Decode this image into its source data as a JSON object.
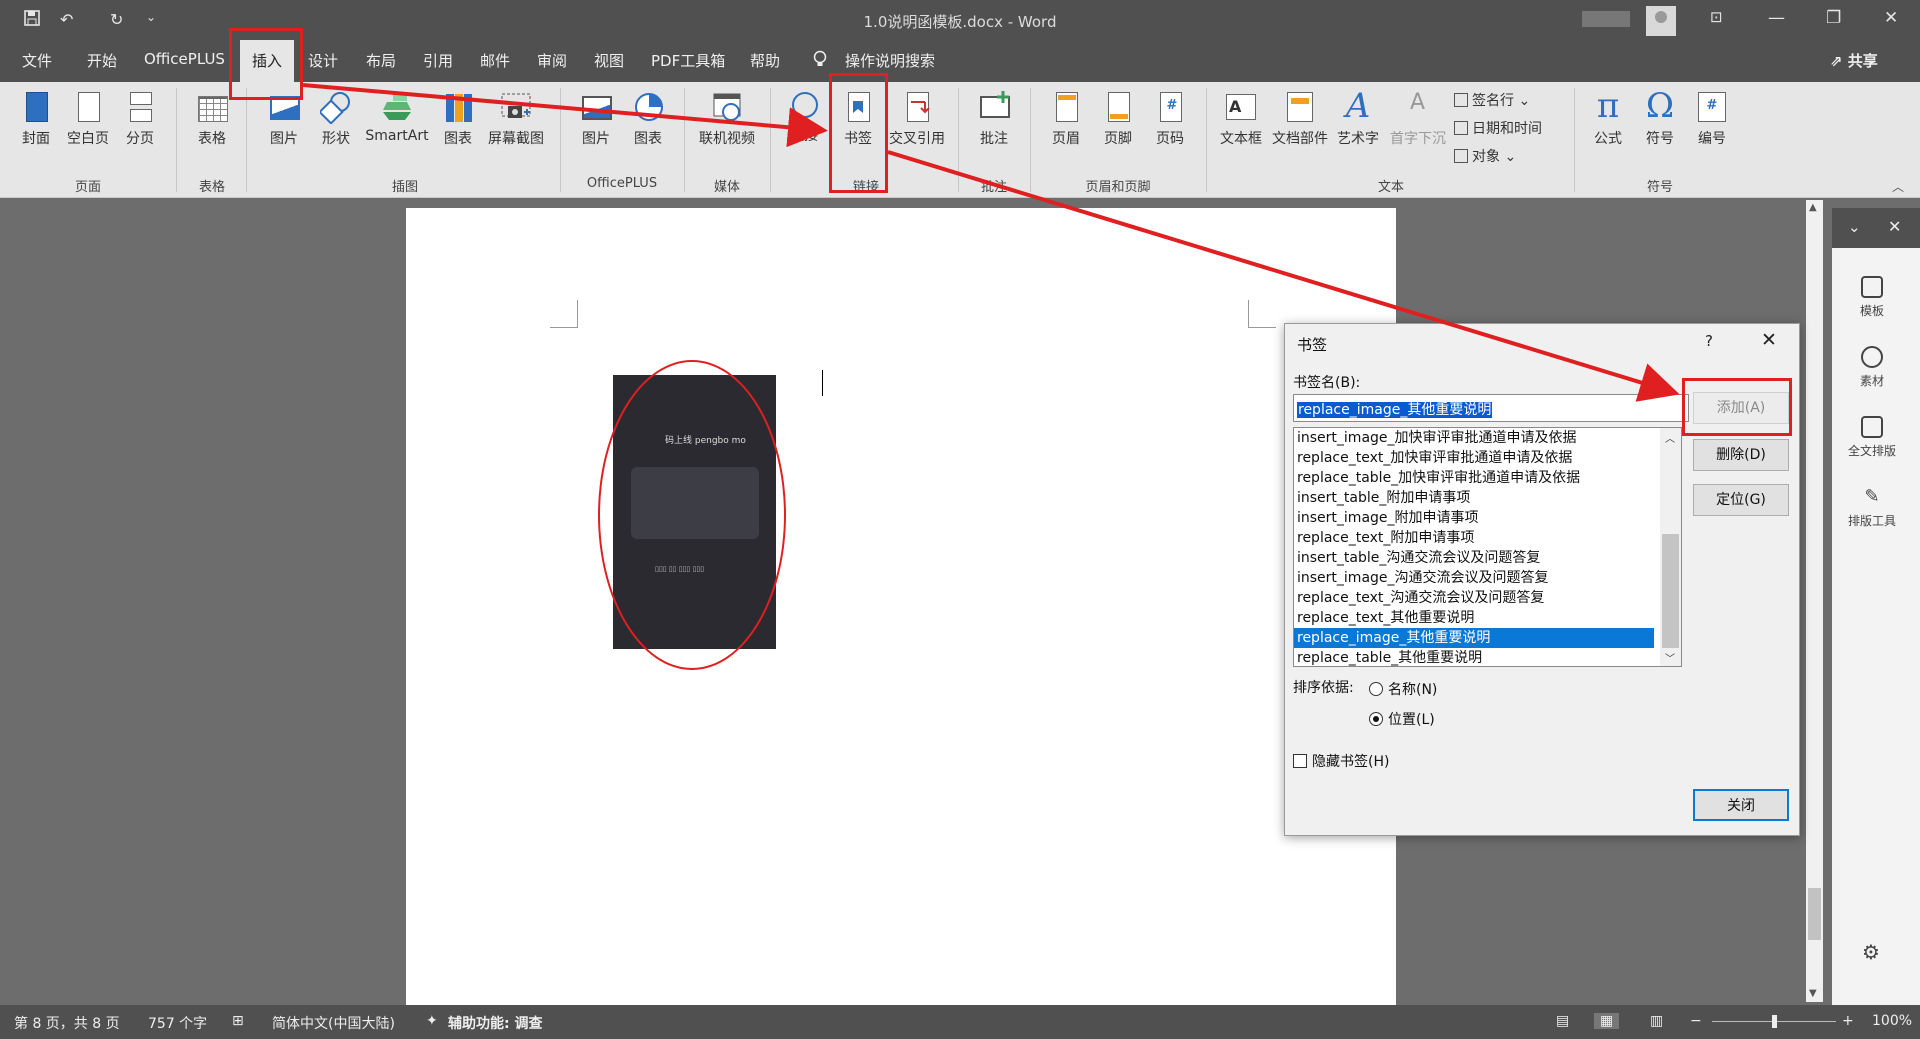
{
  "window": {
    "title": "1.0说明函模板.docx - Word",
    "controls": {
      "ribbon_display": "⊡",
      "minimize": "—",
      "restore": "❐",
      "close": "✕"
    }
  },
  "quick_access": {
    "save_icon": "save-icon",
    "undo": "↶",
    "redo": "↻",
    "more": "⌄"
  },
  "menu_tabs": [
    "文件",
    "开始",
    "OfficePLUS",
    "插入",
    "设计",
    "布局",
    "引用",
    "邮件",
    "审阅",
    "视图",
    "PDF工具箱",
    "帮助"
  ],
  "active_tab": "插入",
  "tell_me": "操作说明搜索",
  "share": "共享",
  "ribbon": {
    "pages": {
      "cover": "封面",
      "blank": "空白页",
      "break": "分页",
      "group": "页面"
    },
    "tables": {
      "table": "表格",
      "group": "表格"
    },
    "illustrations": {
      "picture": "图片",
      "shapes": "形状",
      "smartart": "SmartArt",
      "chart": "图表",
      "screenshot": "屏幕截图",
      "group": "插图"
    },
    "officeplus": {
      "picture": "图片",
      "chart": "图表",
      "group": "OfficePLUS"
    },
    "media": {
      "online_video": "联机视频",
      "group": "媒体"
    },
    "links": {
      "link": "链接",
      "bookmark": "书签",
      "cross_ref": "交叉引用",
      "group": "链接"
    },
    "comments": {
      "comment": "批注",
      "group": "批注"
    },
    "header_footer": {
      "header": "页眉",
      "footer": "页脚",
      "page_number": "页码",
      "group": "页眉和页脚"
    },
    "text": {
      "textbox": "文本框",
      "quick_parts": "文档部件",
      "wordart": "艺术字",
      "dropcap": "首字下沉",
      "signature": "签名行",
      "datetime": "日期和时间",
      "object": "对象",
      "group": "文本"
    },
    "symbols": {
      "equation": "公式",
      "symbol": "符号",
      "number": "编号",
      "group": "符号"
    }
  },
  "document": {
    "image_title": "码上线 pengbo mo",
    "image_footer": "▯▯▯ ▯▯ ▯▯▯ ▯▯▯"
  },
  "side_panel": {
    "items": [
      "模板",
      "素材",
      "全文排版",
      "排版工具"
    ]
  },
  "dialog": {
    "title": "书签",
    "help": "?",
    "close": "✕",
    "name_label": "书签名(B):",
    "name_value": "replace_image_其他重要说明",
    "list": [
      "insert_image_加快审评审批通道申请及依据",
      "replace_text_加快审评审批通道申请及依据",
      "replace_table_加快审评审批通道申请及依据",
      "insert_table_附加申请事项",
      "insert_image_附加申请事项",
      "replace_text_附加申请事项",
      "insert_table_沟通交流会议及问题答复",
      "insert_image_沟通交流会议及问题答复",
      "replace_text_沟通交流会议及问题答复",
      "replace_text_其他重要说明",
      "replace_image_其他重要说明",
      "replace_table_其他重要说明"
    ],
    "selected_index": 10,
    "sort_label": "排序依据:",
    "sort_name": "名称(N)",
    "sort_location": "位置(L)",
    "hidden_label": "隐藏书签(H)",
    "btn_add": "添加(A)",
    "btn_delete": "删除(D)",
    "btn_goto": "定位(G)",
    "btn_close": "关闭"
  },
  "status": {
    "page": "第 8 页，共 8 页",
    "words": "757 个字",
    "language": "简体中文(中国大陆)",
    "accessibility": "辅助功能: 调查",
    "zoom": "100%"
  },
  "colors": {
    "annotation": "#e02020",
    "accent": "#2e6fc0",
    "selection": "#0a78d7"
  }
}
